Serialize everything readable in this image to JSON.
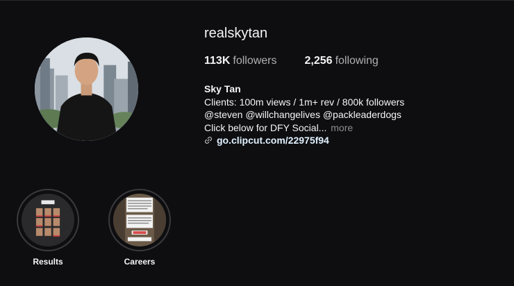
{
  "profile": {
    "username": "realskytan",
    "followers_count": "113K",
    "followers_label": "followers",
    "following_count": "2,256",
    "following_label": "following",
    "display_name": "Sky Tan",
    "bio_line1": "Clients: 100m views / 1m+ rev / 800k followers",
    "bio_line2": "@steven @willchangelives @packleaderdogs",
    "bio_line3": "Click below for DFY Social...",
    "more_label": "more",
    "link_icon": "link-icon",
    "link": "go.clipcut.com/22975f94"
  },
  "highlights": [
    {
      "label": "Results"
    },
    {
      "label": "Careers"
    }
  ],
  "colors": {
    "background": "#0e0e11",
    "text": "#f5f5f5",
    "muted": "#8e8e8e",
    "link": "#e0f1ff"
  }
}
